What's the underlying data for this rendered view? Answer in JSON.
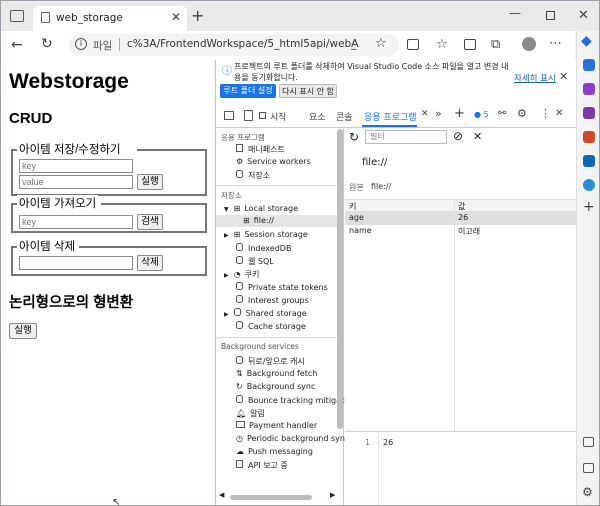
{
  "browser": {
    "tab_title": "web_storage",
    "address_prefix": "파일",
    "address": "c%3A/FrontendWorkspace/5_html5api/web_storage..."
  },
  "page": {
    "title": "Webstorage",
    "crud_heading": "CRUD",
    "save_group": {
      "legend": "아이템 저장/수정하기",
      "key_placeholder": "key",
      "value_placeholder": "value",
      "button": "실행"
    },
    "get_group": {
      "legend": "아이템 가져오기",
      "key_placeholder": "key",
      "button": "검색"
    },
    "delete_group": {
      "legend": "아이템 삭제",
      "button": "삭제"
    },
    "convert_heading": "논리형으로의 형변환",
    "convert_button": "실행"
  },
  "devtools": {
    "notice": {
      "text": "프로젝트의 루트 폴더를 삭제하여 Visual Studio Code 소스 파일을 열고 변경 내용을 동기화합니다.",
      "detail_link": "자세히 표시",
      "primary_button": "루트 폴더 설정",
      "secondary_button": "다시 표시 안 함"
    },
    "tabs": [
      "시작",
      "요소",
      "콘솔",
      "응용 프로그램"
    ],
    "issues_count": "5",
    "filter_placeholder": "필터",
    "sidebar": {
      "app_section": "응용 프로그램",
      "app_items": [
        "매니페스트",
        "Service workers",
        "저장소"
      ],
      "storage_section": "저장소",
      "storage_items": [
        "Local storage",
        "file://",
        "Session storage",
        "IndexedDB",
        "웹 SQL",
        "쿠키",
        "Private state tokens",
        "Interest groups",
        "Shared storage",
        "Cache storage"
      ],
      "bg_section": "Background services",
      "bg_items": [
        "뒤로/앞으로 캐시",
        "Background fetch",
        "Background sync",
        "Bounce tracking mitigati",
        "알림",
        "Payment handler",
        "Periodic background syn",
        "Push messaging",
        "API 보고 중"
      ]
    },
    "origin_title": "file://",
    "origin_label": "원본",
    "origin_value": "file://",
    "table": {
      "headers": [
        "키",
        "값"
      ],
      "rows": [
        {
          "key": "age",
          "value": "26"
        },
        {
          "key": "name",
          "value": "이고래"
        }
      ]
    },
    "preview": {
      "line": "1",
      "value": "26"
    }
  }
}
